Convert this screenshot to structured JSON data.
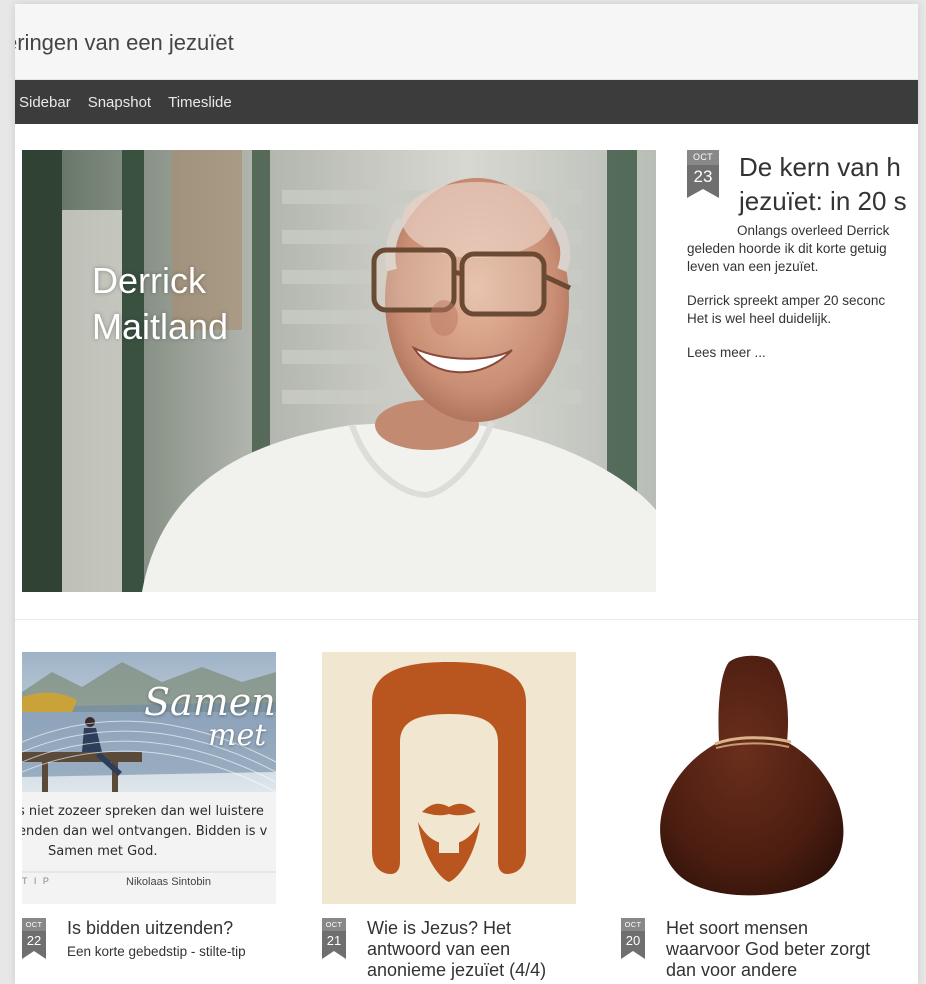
{
  "site": {
    "title": "eringen van een jezuïet"
  },
  "nav": {
    "items": [
      "Sidebar",
      "Snapshot",
      "Timeslide"
    ]
  },
  "featured": {
    "image_caption": [
      "Derrick",
      "Maitland"
    ],
    "date": {
      "month": "OCT",
      "day": "23"
    },
    "title_lines": [
      "De kern van h",
      "jezuïet: in 20 s"
    ],
    "excerpt_lines": [
      [
        "Onlangs overleed Derrick",
        "geleden hoorde ik dit korte getuig",
        "leven van een jezuïet."
      ],
      [
        "Derrick spreekt amper 20 seconc",
        "Het is wel heel duidelijk."
      ]
    ],
    "read_more": "Lees meer ..."
  },
  "posts": [
    {
      "date": {
        "month": "OCT",
        "day": "22"
      },
      "title": "Is bidden uitzenden?",
      "subtitle": "Een korte gebedstip - stilte-tip",
      "image": {
        "script_text": [
          "Samen",
          "met"
        ],
        "quote_lines": [
          "s niet zozeer spreken dan wel luistere",
          "enden dan wel ontvangen. Bidden is v",
          "Samen met God."
        ],
        "footer_left": "T I P",
        "footer_right": "Nikolaas Sintobin"
      }
    },
    {
      "date": {
        "month": "OCT",
        "day": "21"
      },
      "title": "Wie is Jezus? Het antwoord van een anonieme jezuïet (4/4)",
      "subtitle": ""
    },
    {
      "date": {
        "month": "OCT",
        "day": "20"
      },
      "title": "Het soort mensen waarvoor God beter zorgt dan voor andere",
      "subtitle": ""
    }
  ],
  "colors": {
    "nav_bg": "#3c3c3c",
    "badge_month": "#888888",
    "badge_day": "#6f6f6f"
  }
}
